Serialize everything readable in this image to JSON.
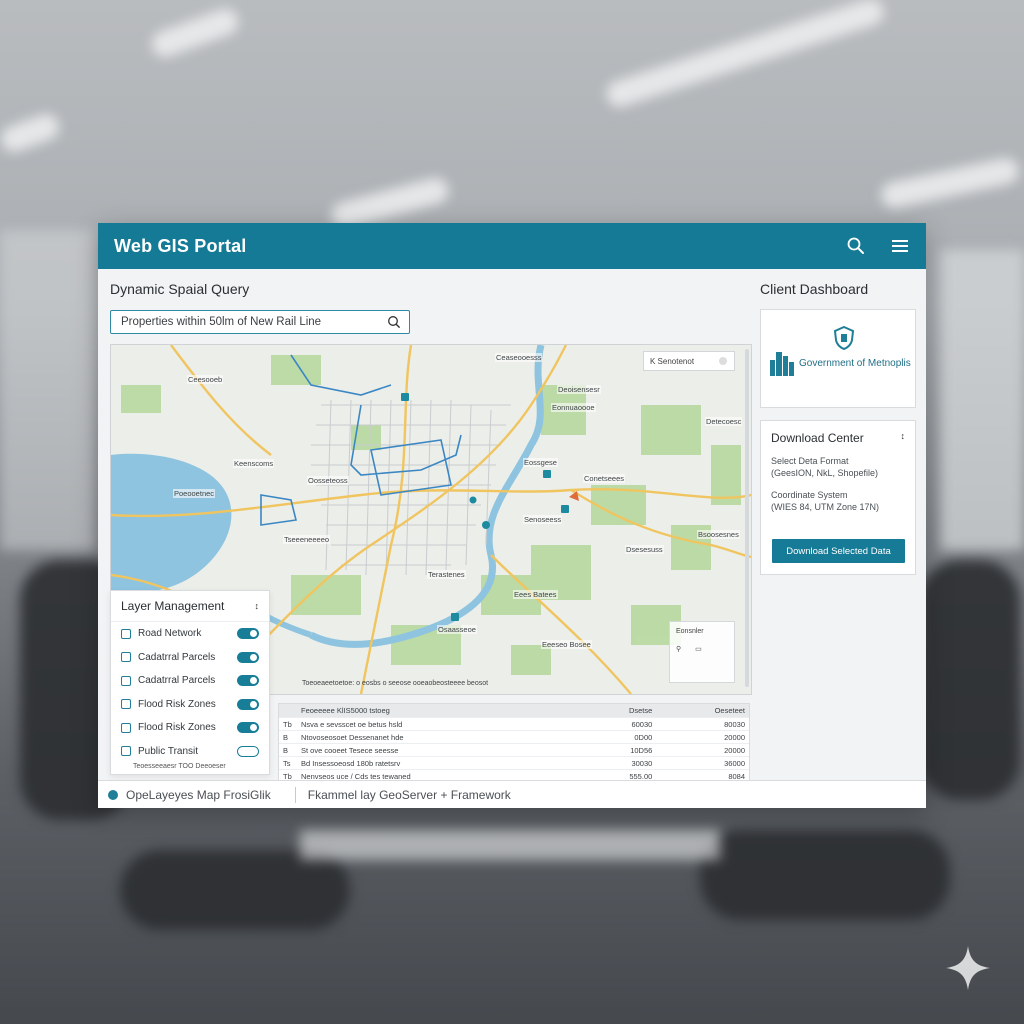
{
  "header": {
    "title": "Web GIS Portal",
    "search_icon": "search-icon",
    "menu_icon": "menu-icon"
  },
  "query": {
    "title": "Dynamic Spaial Query",
    "value": "Properties within 50lm of New Rail Line"
  },
  "map": {
    "search_label": "K Senotenot",
    "labels": [
      "Ceesooeb",
      "Ceaseooesss",
      "Keenscoms",
      "Oosseteoss",
      "Deoisensesr",
      "Poeooetnec",
      "Tseeeneeeeo",
      "Eossgese",
      "Conetseees",
      "Senoseess",
      "Detecoesc",
      "Dsesesuss",
      "Bsoosesnes",
      "Terastenes",
      "Eees Batees",
      "Eeeseo Bosee",
      "Osaasseoe",
      "Eonnuaoooe"
    ],
    "legend_title": "Eonsnler",
    "attribution": "Toeoeaeetoetoe: o eosbs o seeose ooeaobeosteeee beosot"
  },
  "layers": {
    "title": "Layer Management",
    "items": [
      {
        "label": "Road Network",
        "on": true
      },
      {
        "label": "Cadatrral Parcels",
        "on": true
      },
      {
        "label": "Cadatrral Parcels",
        "on": true
      },
      {
        "label": "Flood Risk Zones",
        "on": true
      },
      {
        "label": "Flood Risk Zones",
        "on": true
      },
      {
        "label": "Public Transit",
        "on": false
      }
    ],
    "overflow_text": "Teoesseeaesr  TOO Deeoeser"
  },
  "results_table": {
    "headers": [
      "Feoeeeee KlIS5000 tstoeg",
      "Dsetse",
      "Oeseteet"
    ],
    "rows": [
      [
        "Nsva e sevsscet oe betus hsld",
        "60030",
        "80030"
      ],
      [
        "Ntovoseosoet Dessenanet hde",
        "0D00",
        "20000"
      ],
      [
        "St ove cooeet Tesece seesse",
        "10D56",
        "20000"
      ],
      [
        "Bd Insessoeosd 180b ratetsrv",
        "30030",
        "36000"
      ],
      [
        "Nenvseos uce / Cds tes tewaned",
        "555.00",
        "8084"
      ]
    ],
    "row_marks": [
      "Tb",
      "B",
      "B",
      "Ts",
      "Tb"
    ]
  },
  "footer": {
    "left": "OpeLayeyes Map FrosiGlik",
    "right": "Fkammel lay GeoServer + Framework"
  },
  "dashboard": {
    "title": "Client Dashboard",
    "gov_name": "Government of Metnoplis",
    "download": {
      "title": "Download Center",
      "format_label": "Select Deta Format",
      "format_value": "(GeesION, NkL, Shopefile)",
      "crs_label": "Coordinate System",
      "crs_value": "(WIES 84, UTM Zone 17N)",
      "button": "Download Selected Data"
    }
  },
  "colors": {
    "accent": "#157a95",
    "water": "#8ec4df",
    "park": "#b9d8a4",
    "road": "#f0c560"
  }
}
